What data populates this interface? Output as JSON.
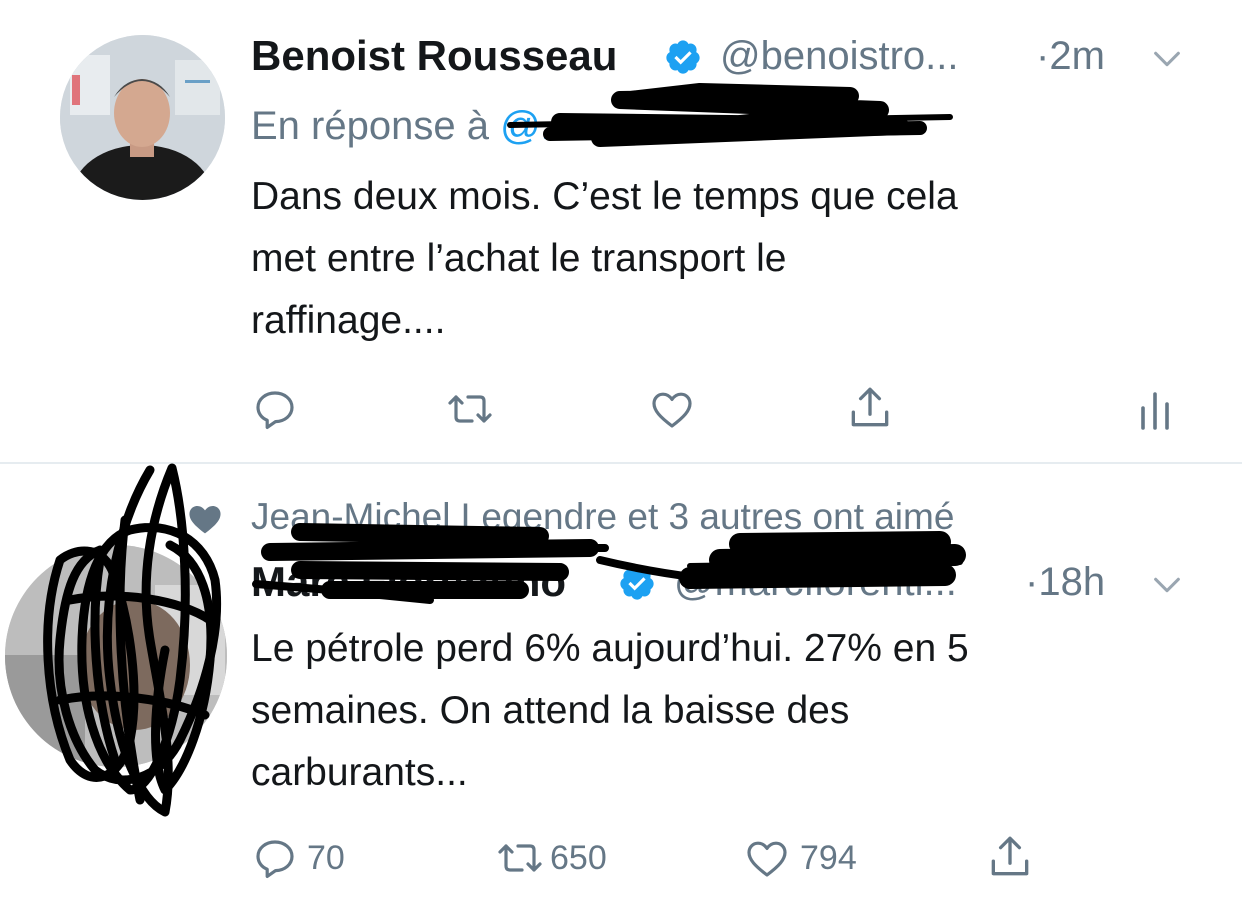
{
  "tweet1": {
    "name": "Benoist Rousseau",
    "handle": "@benoistro...",
    "time": "·2m",
    "reply_prefix": "En réponse à",
    "reply_handle": "@...",
    "text_lines": [
      "Dans deux mois. C’est le temps que cela",
      "met entre l’achat le transport le",
      "raffinage...."
    ],
    "icons": [
      "reply-icon",
      "retweet-icon",
      "like-icon",
      "share-icon",
      "analytics-icon"
    ]
  },
  "tweet2": {
    "social_context": "Jean-Michel Legendre et 3 autres ont aimé",
    "name": "Marc Fiorentino",
    "handle": "@marcfiorenti...",
    "time": "·18h",
    "text_lines": [
      "Le pétrole perd 6% aujourd’hui. 27% en 5",
      "semaines. On attend la baisse des",
      "carburants..."
    ],
    "counts": {
      "reply": "70",
      "retweet": "650",
      "like": "794"
    }
  },
  "colors": {
    "text": "#14171a",
    "secondary": "#657786",
    "link": "#1da1f2",
    "verified": "#1da1f2",
    "divider": "#e6ecf0"
  }
}
